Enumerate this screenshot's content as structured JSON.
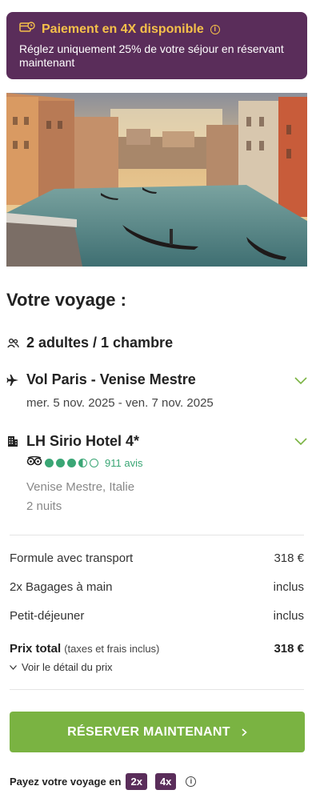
{
  "promo": {
    "title": "Paiement en 4X disponible",
    "text": "Réglez uniquement 25% de votre séjour en réservant maintenant"
  },
  "trip": {
    "heading": "Votre voyage :",
    "travellers": "2 adultes / 1 chambre",
    "flight": {
      "title": "Vol Paris - Venise Mestre",
      "dates": "mer. 5 nov. 2025 - ven. 7 nov. 2025"
    },
    "hotel": {
      "title": "LH Sirio Hotel 4*",
      "rating_value": 3.5,
      "rating_max": 5,
      "reviews": "911 avis",
      "location": "Venise Mestre, Italie",
      "nights": "2 nuits"
    }
  },
  "pricing": {
    "rows": [
      {
        "label": "Formule avec transport",
        "value": "318 €"
      },
      {
        "label": "2x Bagages à main",
        "value": "inclus"
      },
      {
        "label": "Petit-déjeuner",
        "value": "inclus"
      }
    ],
    "total_label": "Prix total",
    "total_note": "(taxes et frais inclus)",
    "total_value": "318 €",
    "detail_link": "Voir le détail du prix"
  },
  "cta": {
    "label": "RÉSERVER MAINTENANT"
  },
  "payment": {
    "label": "Payez votre voyage en",
    "options": [
      "2x",
      "4x"
    ]
  },
  "colors": {
    "promo_bg": "#5a2d5a",
    "promo_title": "#f5c04a",
    "accent_green": "#7ab342",
    "rating_green": "#3aa675"
  },
  "icons": {
    "promo": "card-clock-icon",
    "travellers": "people-icon",
    "flight": "airplane-icon",
    "hotel": "building-icon",
    "reviews": "tripadvisor-owl-icon"
  }
}
